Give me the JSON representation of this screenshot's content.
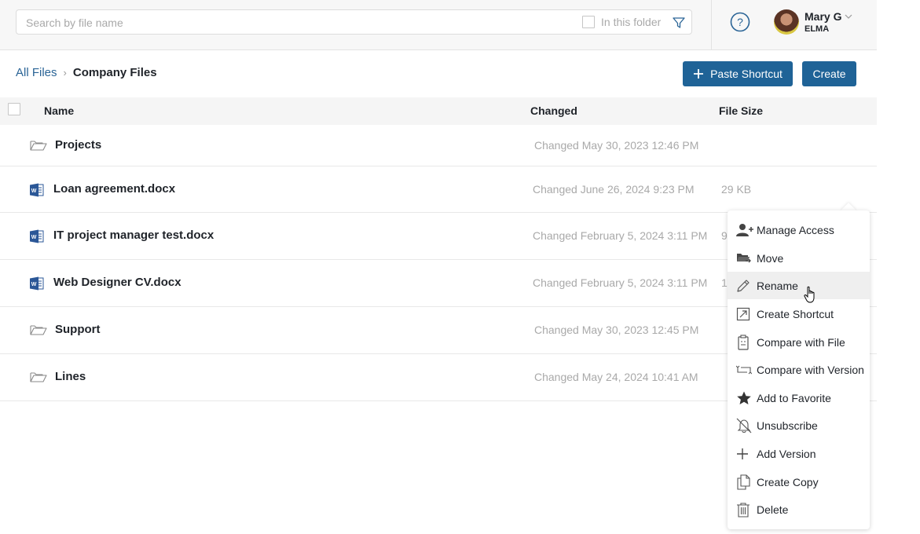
{
  "topbar": {
    "search_placeholder": "Search by file name",
    "search_value": "",
    "in_this_folder_label": "In this folder",
    "in_this_folder_checked": false,
    "user": {
      "name": "Mary G",
      "org": "ELMA"
    }
  },
  "breadcrumb": {
    "root": "All Files",
    "separator": "›",
    "current": "Company Files"
  },
  "toolbar": {
    "paste_shortcut_label": "Paste Shortcut",
    "create_label": "Create"
  },
  "table": {
    "headers": {
      "name": "Name",
      "changed": "Changed",
      "size": "File Size"
    },
    "rows": [
      {
        "type": "folder",
        "name": "Projects",
        "changed": "Changed May 30, 2023 12:46 PM",
        "size": ""
      },
      {
        "type": "docx",
        "name": "Loan agreement.docx",
        "changed": "Changed June 26, 2024 9:23 PM",
        "size": "29 KB"
      },
      {
        "type": "docx",
        "name": "IT project manager test.docx",
        "changed": "Changed February 5, 2024 3:11 PM",
        "size": "9"
      },
      {
        "type": "docx",
        "name": "Web Designer CV.docx",
        "changed": "Changed February 5, 2024 3:11 PM",
        "size": "1"
      },
      {
        "type": "folder",
        "name": "Support",
        "changed": "Changed May 30, 2023 12:45 PM",
        "size": ""
      },
      {
        "type": "folder",
        "name": "Lines",
        "changed": "Changed May 24, 2024 10:41 AM",
        "size": ""
      }
    ]
  },
  "context_menu": {
    "items": [
      {
        "label": "Manage Access",
        "icon": "user-plus-icon"
      },
      {
        "label": "Move",
        "icon": "folder-move-icon"
      },
      {
        "label": "Rename",
        "icon": "pencil-icon",
        "hovered": true
      },
      {
        "label": "Create Shortcut",
        "icon": "shortcut-arrow-icon"
      },
      {
        "label": "Compare with File",
        "icon": "clipboard-icon"
      },
      {
        "label": "Compare with Version",
        "icon": "compare-arrows-icon"
      },
      {
        "label": "Add to Favorite",
        "icon": "star-icon"
      },
      {
        "label": "Unsubscribe",
        "icon": "bell-off-icon"
      },
      {
        "label": "Add Version",
        "icon": "plus-icon"
      },
      {
        "label": "Create Copy",
        "icon": "copy-icon"
      },
      {
        "label": "Delete",
        "icon": "trash-icon"
      }
    ]
  },
  "colors": {
    "primary_button": "#1f6397",
    "link": "#2a6496",
    "word_icon": "#2b5797",
    "muted_text": "#a9a9a9"
  }
}
